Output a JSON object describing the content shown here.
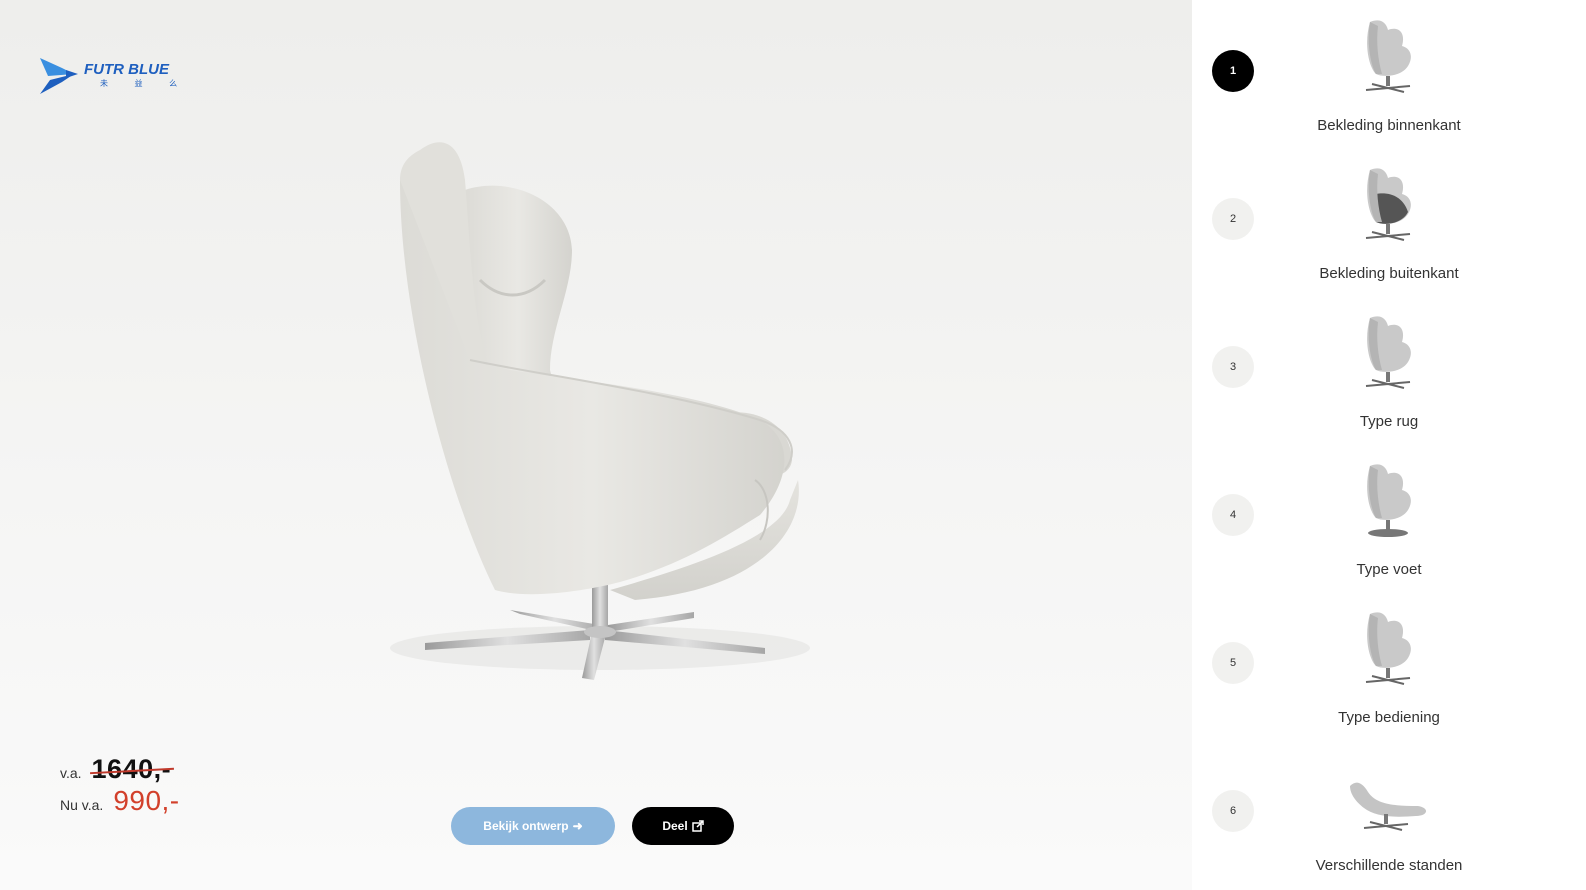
{
  "brand": {
    "name": "FUTR BLUE",
    "sub": "未 益 么",
    "color": "#1e5fbf"
  },
  "price": {
    "prefix_old": "v.a.",
    "old_price": "1640,-",
    "prefix_new": "Nu v.a.",
    "new_price": "990,-"
  },
  "buttons": {
    "view_label": "Bekijk ontwerp",
    "share_label": "Deel"
  },
  "steps": [
    {
      "number": "1",
      "label": "Bekleding binnenkant",
      "active": true
    },
    {
      "number": "2",
      "label": "Bekleding buitenkant",
      "active": false
    },
    {
      "number": "3",
      "label": "Type rug",
      "active": false
    },
    {
      "number": "4",
      "label": "Type voet",
      "active": false
    },
    {
      "number": "5",
      "label": "Type bediening",
      "active": false
    },
    {
      "number": "6",
      "label": "Verschillende standen",
      "active": false
    }
  ],
  "colors": {
    "accent_button": "#8db7dd",
    "price_red": "#d2402b",
    "active_step": "#000000"
  }
}
